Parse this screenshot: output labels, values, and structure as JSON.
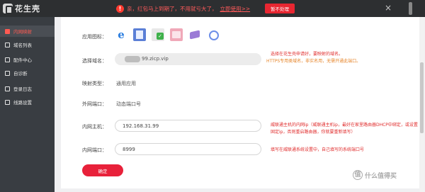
{
  "topbar": {
    "logo_text": "花生壳",
    "notice_text": "亲，红包马上到期了，不用就亏大了，",
    "notice_link": "立即使用>>",
    "dismiss_label": "暂不处理",
    "close_glyph": "×"
  },
  "sidebar": {
    "items": [
      {
        "label": "内网映射",
        "icon": "link-icon"
      },
      {
        "label": "域名列表",
        "icon": "list-icon"
      },
      {
        "label": "配件中心",
        "icon": "grid-icon"
      },
      {
        "label": "自诊断",
        "icon": "diagnose-icon"
      },
      {
        "label": "登录日志",
        "icon": "log-icon"
      },
      {
        "label": "线路设置",
        "icon": "settings-icon"
      }
    ]
  },
  "form": {
    "app_icon_label": "应用图标：",
    "domain_label": "选择域名：",
    "domain_value": "99.zicp.vip",
    "map_type_label": "映射类型：",
    "map_type_value": "通用应用",
    "external_port_label": "外网端口：",
    "external_port_value": "动态端口号",
    "internal_host_label": "内网主机：",
    "internal_host_value": "192.168.31.99",
    "internal_port_label": "内网端口：",
    "internal_port_value": "8999",
    "confirm_label": "确定"
  },
  "notes": {
    "domain_note_1": "选择在花生壳申请好，要映射的域名。",
    "domain_note_2": "HTTPS专用类域名，非实名用，无需开通此端口。",
    "host_note_1": "威联通主机的内网ip（威联通主机ip，最好在家里路由器DHCP中绑定，或设置",
    "host_note_2": "固定ip，否则重启路由器，你就要重新填写）",
    "port_note": "填写在威联通系统设置中，自己填写的系统端口号"
  },
  "watermark": {
    "mark": "值",
    "text": "什么值得买"
  },
  "colors": {
    "accent_red": "#e8213a",
    "note_red": "#e02b2b",
    "note_orange": "#e6852b",
    "sidebar_bg": "#393d42",
    "topbar_bg": "#2d2f31"
  }
}
